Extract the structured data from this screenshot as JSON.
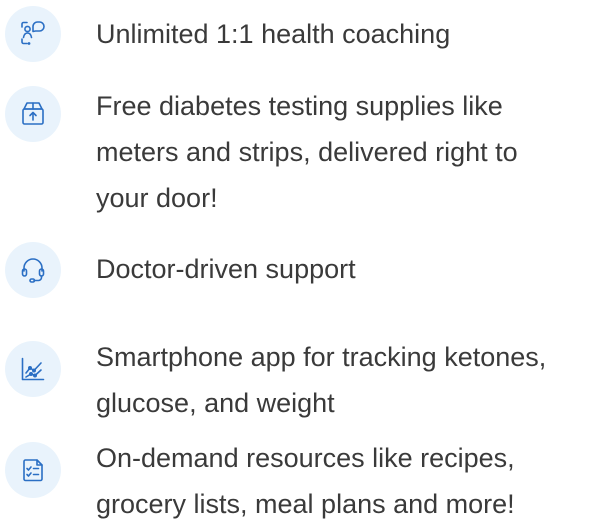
{
  "accent_color": "#2b6fc4",
  "icon_bg_color": "#e9f3fc",
  "text_color": "#3a3a3a",
  "benefits": [
    {
      "icon": "coaching-chat-icon",
      "text": "Unlimited 1:1 health coaching"
    },
    {
      "icon": "supply-box-icon",
      "text": "Free diabetes testing supplies like meters and strips, delivered right to your door!"
    },
    {
      "icon": "headset-icon",
      "text": "Doctor-driven support"
    },
    {
      "icon": "trend-chart-icon",
      "text": "Smartphone app for tracking ketones, glucose, and weight"
    },
    {
      "icon": "checklist-icon",
      "text": "On-demand resources like recipes, grocery lists, meal plans and more!"
    }
  ]
}
